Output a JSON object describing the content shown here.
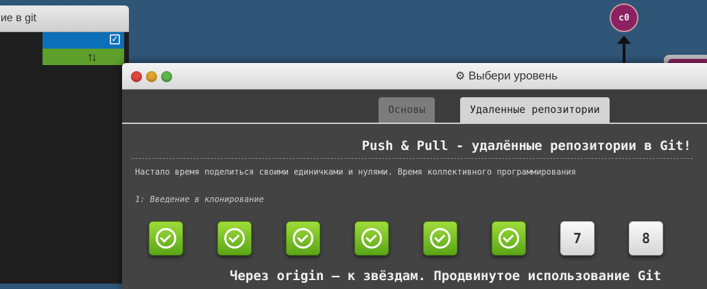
{
  "sidebar": {
    "title": "ние в git"
  },
  "graph": {
    "node_label": "c0"
  },
  "dialog": {
    "title": "Выбери уровень",
    "tabs": [
      {
        "label": "Основы",
        "active": false
      },
      {
        "label": "Удаленные репозитории",
        "active": true
      }
    ],
    "sequence_title": "Push & Pull - удалённые репозитории в Git!",
    "sequence_description": "Настало время поделиться своими единичками и нулями. Время коллективного программирования",
    "lesson_title": "1: Введение в клонирование",
    "levels": [
      {
        "status": "done",
        "label": ""
      },
      {
        "status": "done",
        "label": ""
      },
      {
        "status": "done",
        "label": ""
      },
      {
        "status": "done",
        "label": ""
      },
      {
        "status": "done",
        "label": ""
      },
      {
        "status": "done",
        "label": ""
      },
      {
        "status": "todo",
        "label": "7"
      },
      {
        "status": "todo",
        "label": "8"
      }
    ],
    "next_sequence_title": "Через origin – к звёздам. Продвинутое использование Git"
  },
  "colors": {
    "done": "#6fbf1f",
    "accent_blue": "#0d6fb8",
    "accent_green": "#5e9e2a",
    "node": "#8b2063"
  },
  "icons": {
    "gear": "gear-icon",
    "check": "checkbox-icon",
    "sync": "sync-arrows-icon"
  }
}
